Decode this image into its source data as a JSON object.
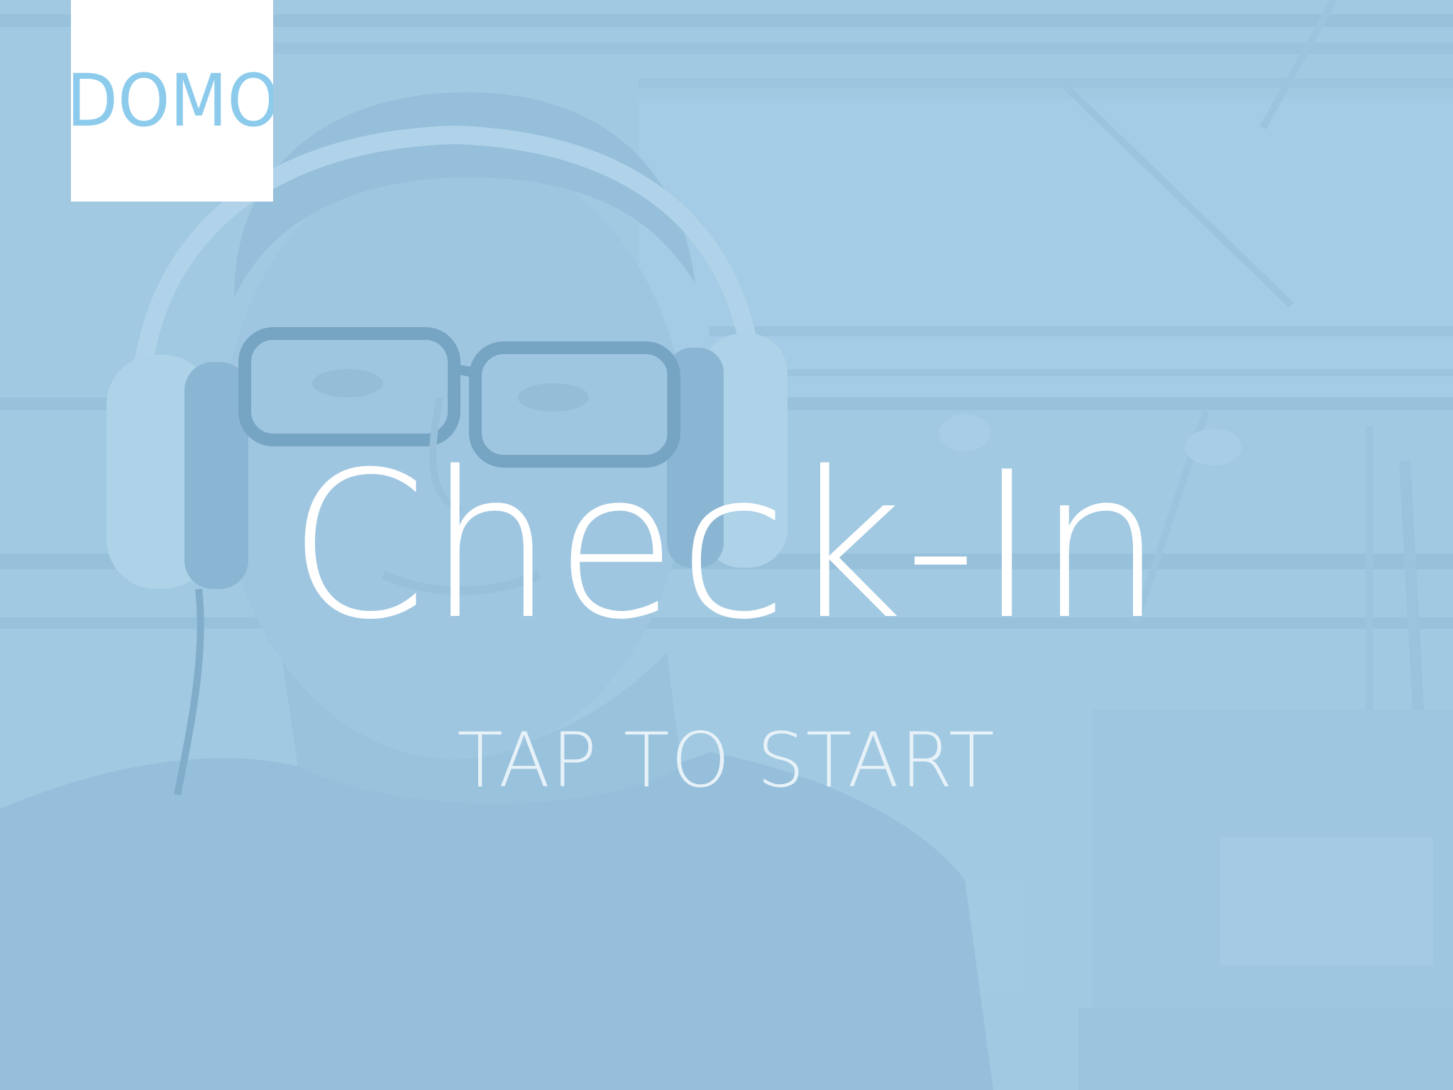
{
  "logo": {
    "text": "DOMO",
    "color": "#8ccbec"
  },
  "main": {
    "title": "Check-In",
    "cta": "TAP TO START"
  },
  "colors": {
    "overlay": "#9fc6df",
    "title_text": "#ffffff",
    "cta_text": "#e6f1f8"
  }
}
